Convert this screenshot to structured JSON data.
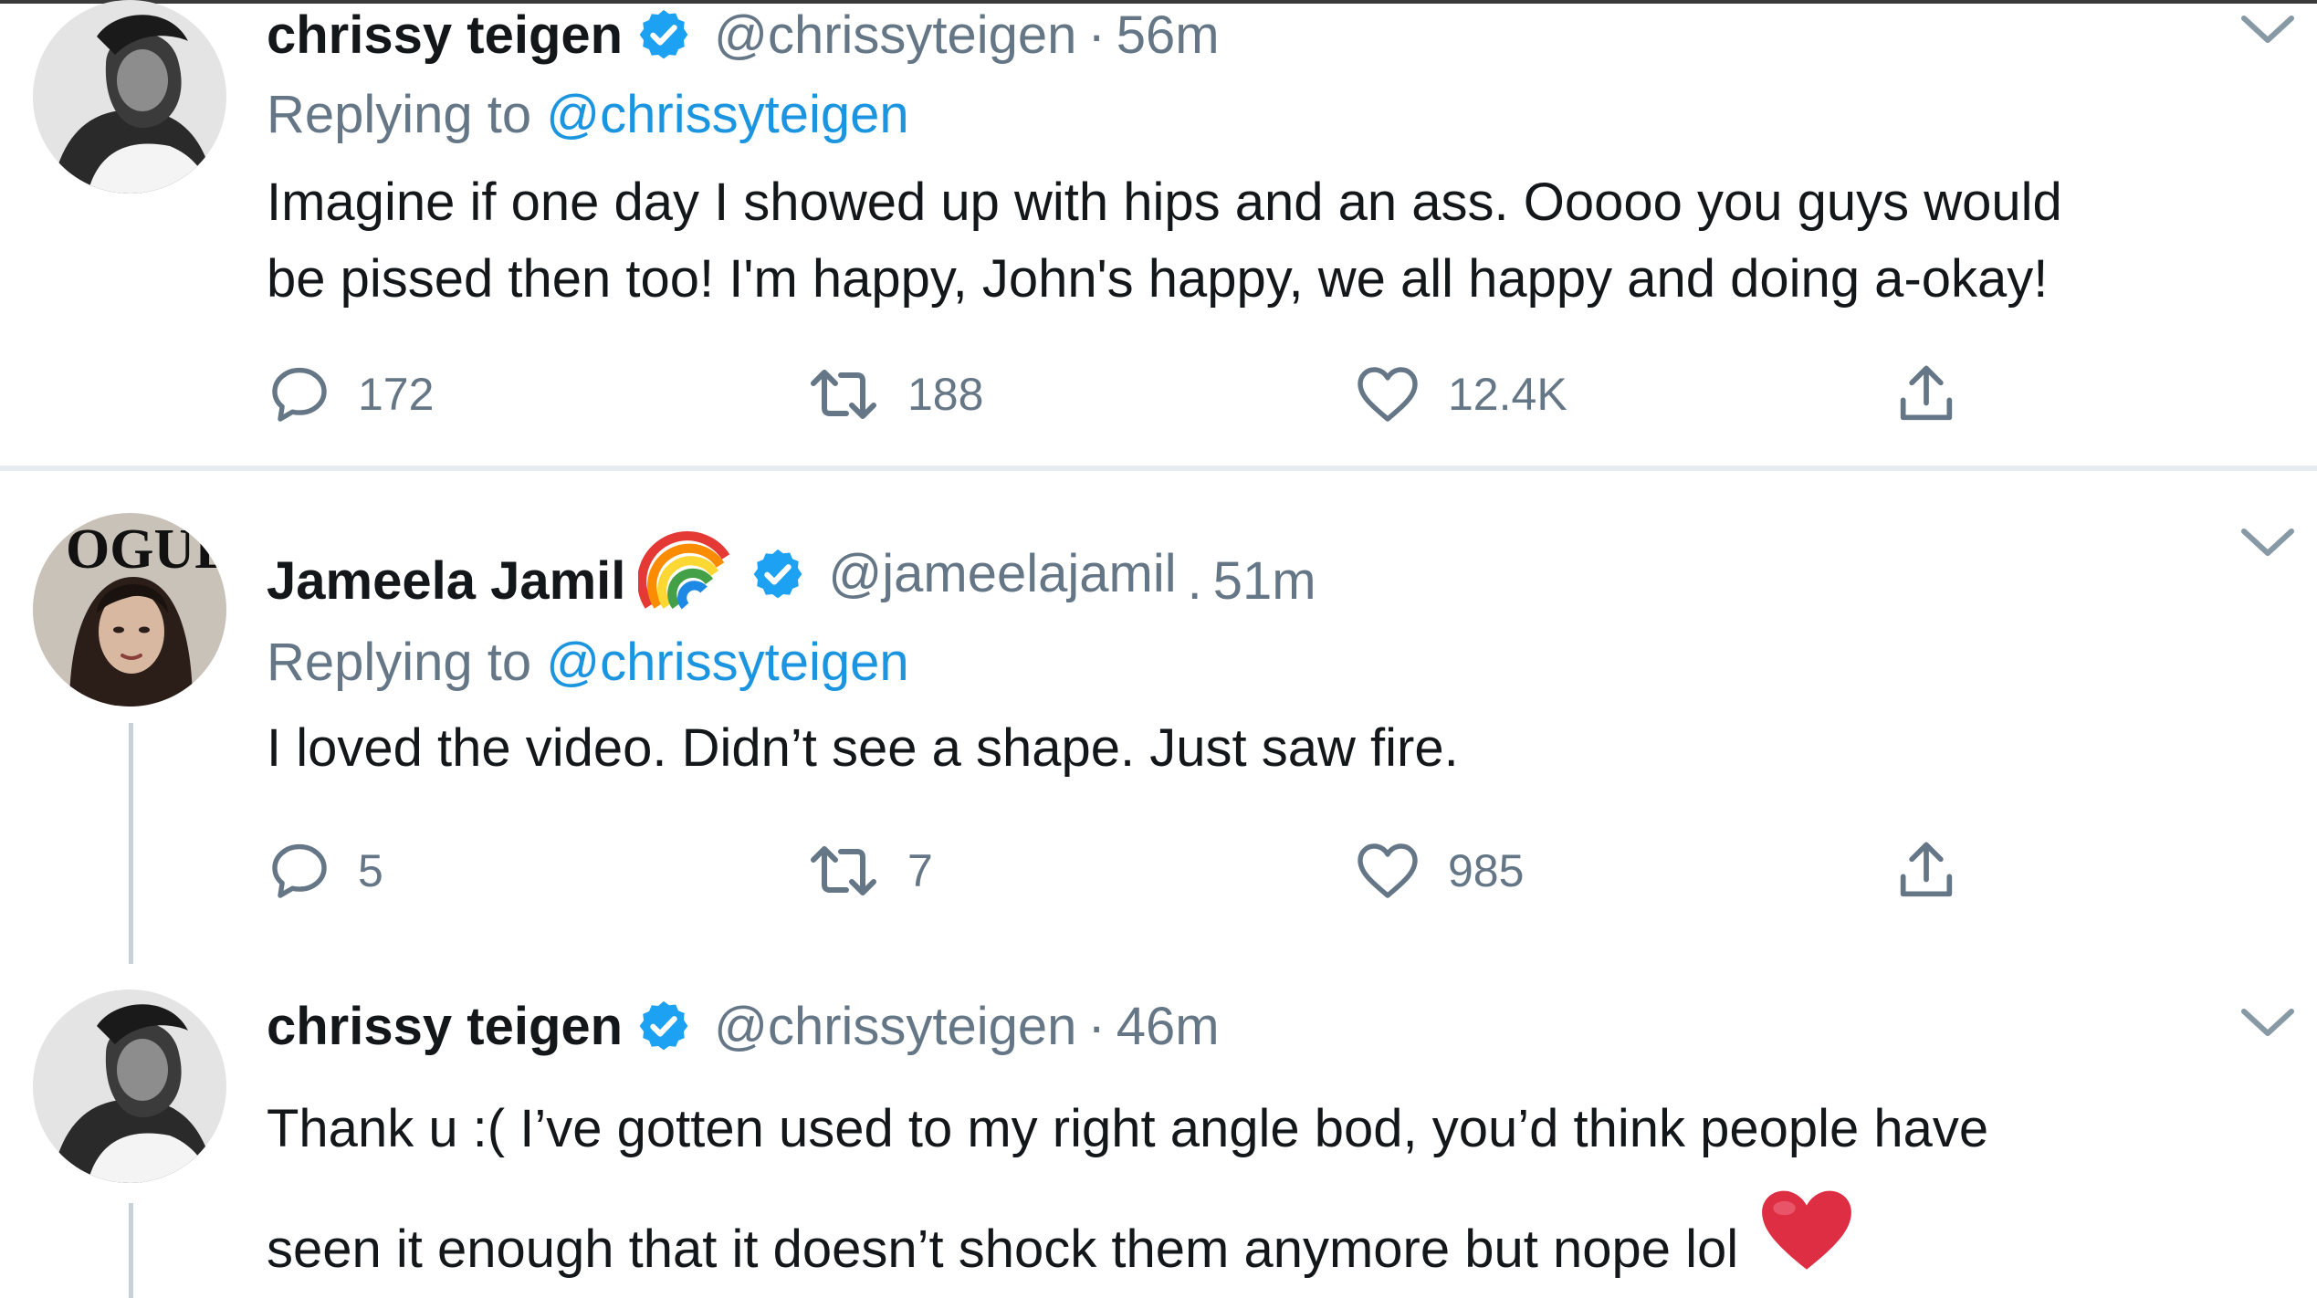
{
  "tweets": [
    {
      "name": "chrissy teigen",
      "handle": "@chrissyteigen",
      "separator": "·",
      "time": "56m",
      "replying_prefix": "Replying to",
      "replying_to": "@chrissyteigen",
      "text_lines": [
        "Imagine if one day I showed up with hips and an ass. Ooooo you guys would",
        "be pissed then too! I'm happy, John's happy, we all happy and doing a-okay!"
      ],
      "replies": "172",
      "retweets": "188",
      "likes": "12.4K"
    },
    {
      "name": "Jameela Jamil",
      "name_emoji": "rainbow",
      "handle": "@jameelajamil",
      "separator": ".",
      "time": "51m",
      "replying_prefix": "Replying to",
      "replying_to": "@chrissyteigen",
      "text_lines": [
        "I loved the video. Didn’t see a shape. Just saw fire."
      ],
      "replies": "5",
      "retweets": "7",
      "likes": "985",
      "avatar_text": "OGUE"
    },
    {
      "name": "chrissy teigen",
      "handle": "@chrissyteigen",
      "separator": "·",
      "time": "46m",
      "text_lines": [
        "Thank u :( I’ve gotten used to my right angle bod, you’d think people have",
        "seen it enough that it doesn’t shock them anymore but nope lol"
      ],
      "trailing_emoji": "red-heart"
    }
  ],
  "icons": {
    "reply": "speech-bubble-icon",
    "retweet": "retweet-arrows-icon",
    "like": "heart-outline-icon",
    "share": "share-upload-icon",
    "more": "chevron-down-icon",
    "verified": "verified-badge-icon"
  },
  "colors": {
    "text": "#14171a",
    "secondary": "#657786",
    "link": "#1b95e0",
    "verified": "#1da1f2",
    "divider": "#e6ecf0",
    "thread_line": "#c9d1d8"
  }
}
